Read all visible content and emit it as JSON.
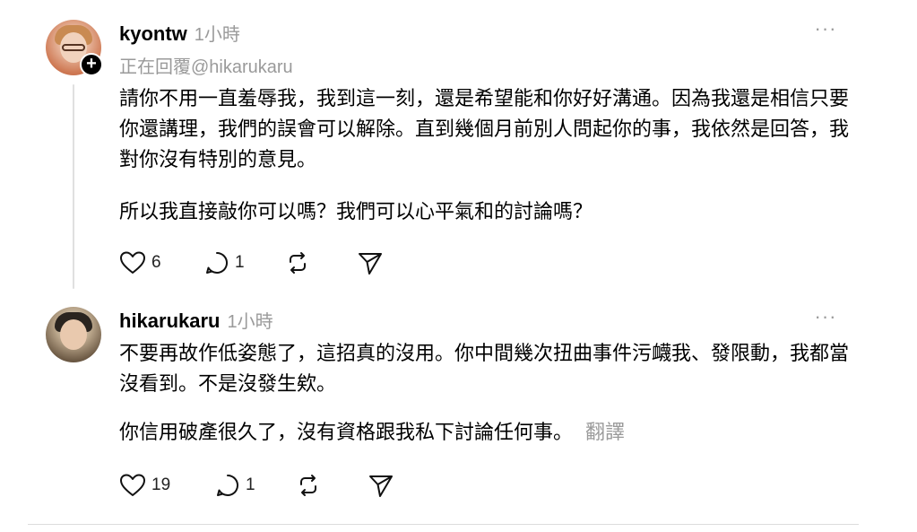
{
  "posts": [
    {
      "username": "kyontw",
      "time": "1小時",
      "reply_to": "正在回覆@hikarukaru",
      "paragraphs": [
        "請你不用一直羞辱我，我到這一刻，還是希望能和你好好溝通。因為我還是相信只要你還講理，我們的誤會可以解除。直到幾個月前別人問起你的事，我依然是回答，我對你沒有特別的意見。",
        "所以我直接敲你可以嗎？我們可以心平氣和的討論嗎？"
      ],
      "likes": "6",
      "replies": "1",
      "more_label": "···",
      "follow_label": "+"
    },
    {
      "username": "hikarukaru",
      "time": "1小時",
      "paragraphs": [
        "不要再故作低姿態了，這招真的沒用。你中間幾次扭曲事件污衊我、發限動，我都當沒看到。不是沒發生欸。",
        "你信用破產很久了，沒有資格跟我私下討論任何事。"
      ],
      "translate_label": "翻譯",
      "likes": "19",
      "replies": "1",
      "more_label": "···"
    }
  ],
  "icons": {
    "like": "heart-icon",
    "reply": "comment-icon",
    "repost": "repost-icon",
    "share": "send-icon",
    "more": "more-icon"
  },
  "colors": {
    "text": "#000000",
    "muted": "#9a9a9a",
    "divider": "#dcdcdc"
  }
}
